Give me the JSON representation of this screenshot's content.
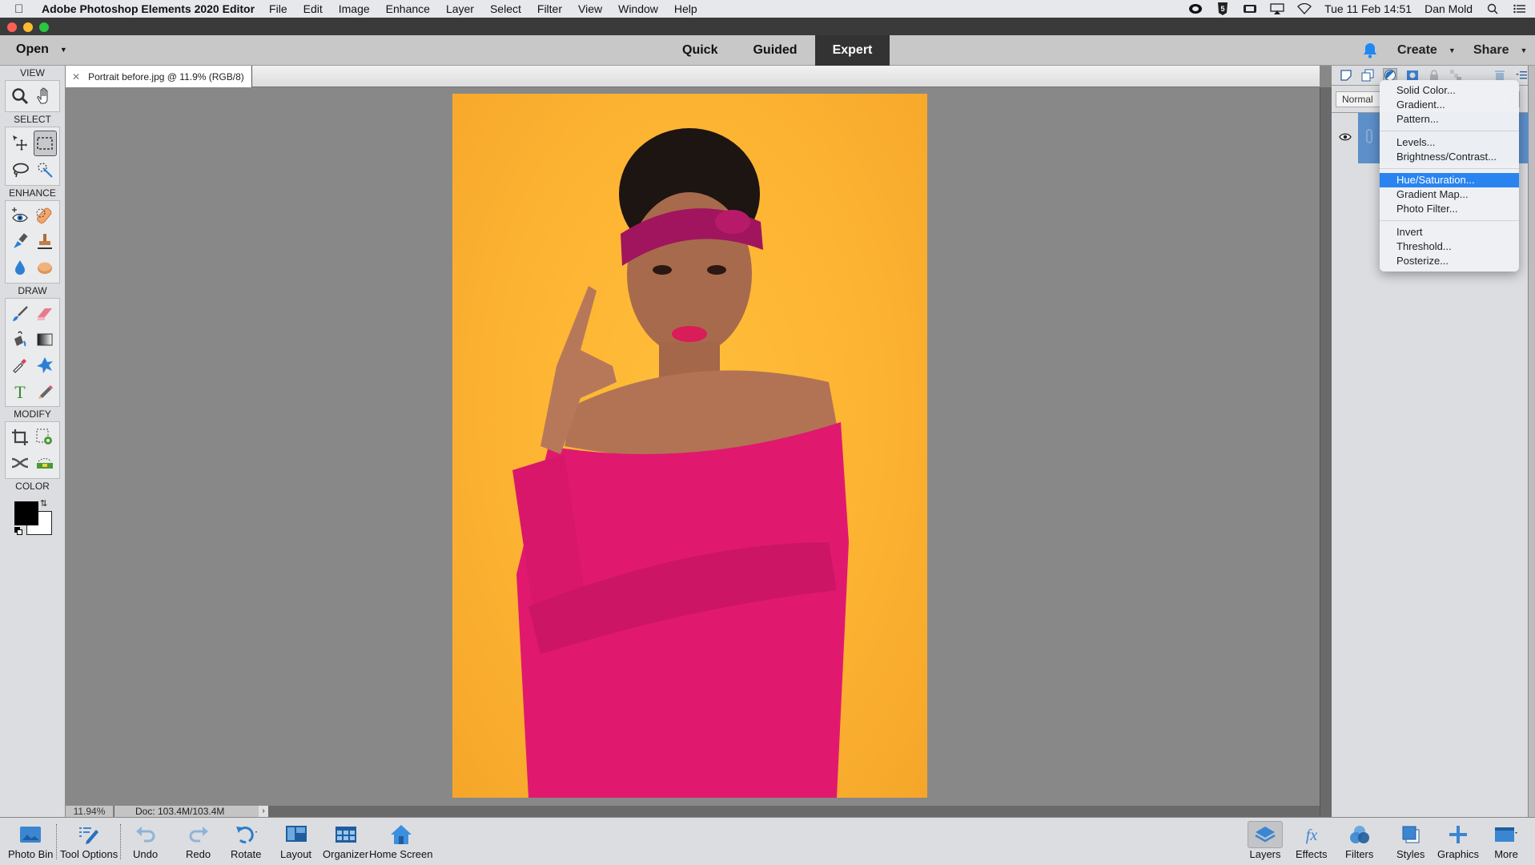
{
  "menubar": {
    "app_name": "Adobe Photoshop Elements 2020 Editor",
    "items": [
      "File",
      "Edit",
      "Image",
      "Enhance",
      "Layer",
      "Select",
      "Filter",
      "View",
      "Window",
      "Help"
    ],
    "datetime": "Tue 11 Feb  14:51",
    "user": "Dan Mold"
  },
  "modebar": {
    "open_label": "Open",
    "modes": [
      {
        "label": "Quick",
        "active": false
      },
      {
        "label": "Guided",
        "active": false
      },
      {
        "label": "Expert",
        "active": true
      }
    ],
    "create_label": "Create",
    "share_label": "Share"
  },
  "toolbox": {
    "sections": {
      "view": "VIEW",
      "select": "SELECT",
      "enhance": "ENHANCE",
      "draw": "DRAW",
      "modify": "MODIFY",
      "color": "COLOR"
    },
    "foreground_color": "#000000",
    "background_color": "#ffffff",
    "selected_tool": "rectangular-marquee"
  },
  "document": {
    "tab_title": "Portrait before.jpg @ 11.9% (RGB/8)",
    "zoom": "11.94%",
    "doc_size": "Doc: 103.4M/103.4M"
  },
  "layers_panel": {
    "blend_mode": "Normal"
  },
  "adjustment_menu": {
    "groups": [
      [
        "Solid Color...",
        "Gradient...",
        "Pattern..."
      ],
      [
        "Levels...",
        "Brightness/Contrast..."
      ],
      [
        "Hue/Saturation...",
        "Gradient Map...",
        "Photo Filter..."
      ],
      [
        "Invert",
        "Threshold...",
        "Posterize..."
      ]
    ],
    "highlighted": "Hue/Saturation..."
  },
  "taskbar": {
    "left": [
      {
        "label": "Photo Bin"
      },
      {
        "label": "Tool Options"
      },
      {
        "label": "Undo"
      },
      {
        "label": "Redo"
      },
      {
        "label": "Rotate"
      },
      {
        "label": "Layout"
      },
      {
        "label": "Organizer"
      },
      {
        "label": "Home Screen"
      }
    ],
    "right": [
      {
        "label": "Layers",
        "active": true
      },
      {
        "label": "Effects"
      },
      {
        "label": "Filters"
      },
      {
        "label": "Styles"
      },
      {
        "label": "Graphics"
      },
      {
        "label": "More"
      }
    ]
  },
  "colors": {
    "accent_blue": "#2a84f0",
    "mode_active_bg": "#333333",
    "layer_selected": "#5d8fc9",
    "photo_background": "#fdb332",
    "dress": "#e0196f"
  }
}
